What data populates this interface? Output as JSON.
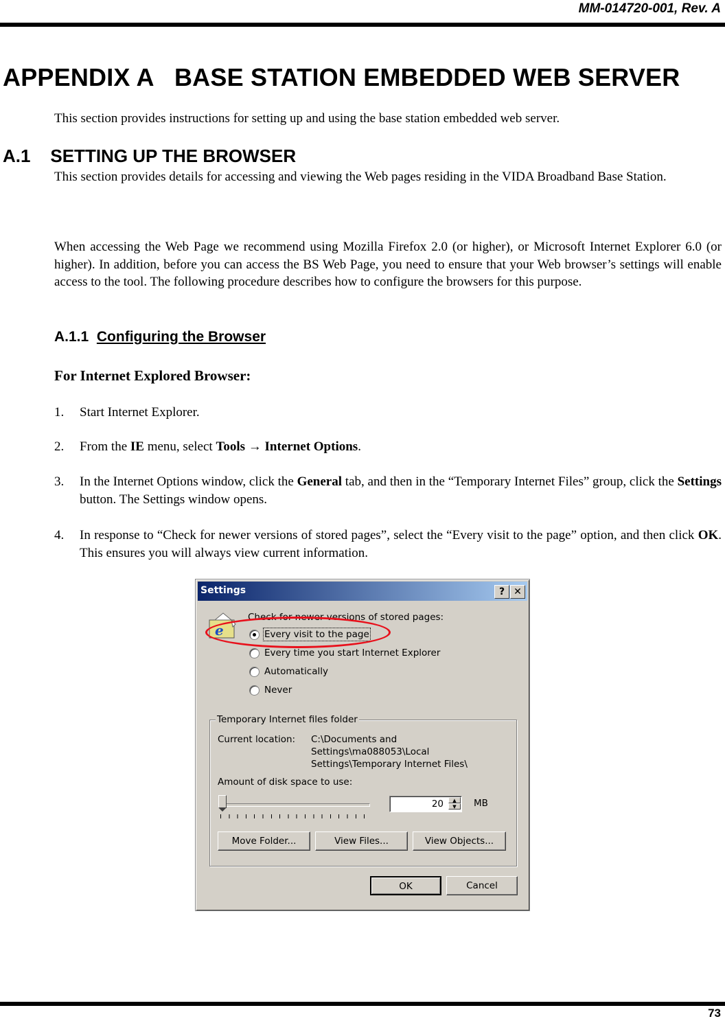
{
  "header": {
    "doc_id": "MM-014720-001, Rev. A"
  },
  "footer": {
    "page_number": "73"
  },
  "appendix": {
    "label": "APPENDIX A",
    "title": "BASE STATION EMBEDDED WEB SERVER",
    "intro": "This section provides instructions for setting up and using the base station embedded web server."
  },
  "section_a1": {
    "number": "A.1",
    "title": "SETTING UP THE BROWSER",
    "para1": "This section provides details for accessing and viewing the Web pages residing in the VIDA Broadband Base Station.",
    "para2": "When accessing the Web Page we recommend using Mozilla Firefox 2.0 (or higher), or Microsoft Internet Explorer 6.0 (or higher).  In addition, before you can access the BS Web Page, you need to ensure that your Web browser’s settings will enable access to the tool.  The following procedure describes how to configure the browsers for this purpose."
  },
  "section_a11": {
    "number": "A.1.1",
    "title": "Configuring the Browser",
    "subheading": "For Internet Explored Browser:",
    "steps": [
      {
        "num": "1.",
        "parts": [
          "Start Internet Explorer."
        ]
      },
      {
        "num": "2.",
        "pre": "From the ",
        "b1": "IE",
        "mid1": " menu, select ",
        "b2": "Tools → Internet Options",
        "post": "."
      },
      {
        "num": "3.",
        "pre": "In the Internet Options window, click the ",
        "b1": "General",
        "mid1": " tab, and then in the “Temporary Internet Files” group, click the ",
        "b2": "Settings",
        "post": " button.  The Settings window opens."
      },
      {
        "num": "4.",
        "pre": "In response to “Check for newer versions of stored pages”, select the “Every visit to the page” option, and then click ",
        "b1": "OK",
        "post": ".  This ensures you will always view current information."
      }
    ]
  },
  "dialog": {
    "title": "Settings",
    "help_label": "?",
    "close_label": "✕",
    "check_label": "Check for newer versions of stored pages:",
    "options": [
      {
        "label": "Every visit to the page",
        "selected": true
      },
      {
        "label": "Every time you start Internet Explorer",
        "selected": false
      },
      {
        "label": "Automatically",
        "selected": false
      },
      {
        "label": "Never",
        "selected": false
      }
    ],
    "group_title": "Temporary Internet files folder",
    "current_location_label": "Current location:",
    "current_location_lines": [
      "C:\\Documents and",
      "Settings\\ma088053\\Local",
      "Settings\\Temporary Internet Files\\"
    ],
    "disk_space_label": "Amount of disk space to use:",
    "disk_space_value": "20",
    "disk_space_unit": "MB",
    "slider_fraction": 0.0,
    "buttons": {
      "move_folder": "Move Folder...",
      "view_files": "View Files...",
      "view_objects": "View Objects...",
      "ok": "OK",
      "cancel": "Cancel"
    },
    "highlight_color": "#e8101b"
  }
}
